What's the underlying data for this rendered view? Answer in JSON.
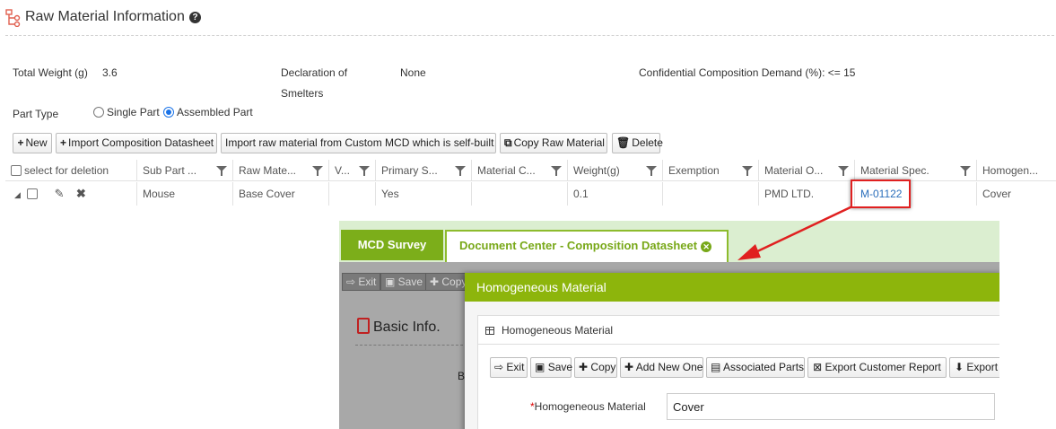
{
  "header": {
    "title": "Raw Material Information",
    "help_icon": "?"
  },
  "summary": {
    "total_weight_label": "Total Weight (g)",
    "total_weight_value": "3.6",
    "smelters_label_line1": "Declaration of",
    "smelters_label_line2": "Smelters",
    "smelters_value": "None",
    "confidential_label": "Confidential Composition Demand (%): <= 15"
  },
  "part_type": {
    "label": "Part Type",
    "options": [
      "Single Part",
      "Assembled Part"
    ],
    "selected": "Assembled Part"
  },
  "toolbar": {
    "new": "New",
    "import_datasheet": "Import Composition Datasheet",
    "import_custom": "Import raw material from Custom MCD which is self-built",
    "copy": "Copy Raw Material",
    "delete": "Delete"
  },
  "grid": {
    "select_label": "select for deletion",
    "columns": [
      "Sub Part ...",
      "Raw Mate...",
      "V...",
      "Primary S...",
      "Material C...",
      "Weight(g)",
      "Exemption",
      "Material O...",
      "Material Spec.",
      "Homogen..."
    ],
    "row": {
      "sub_part": "Mouse",
      "raw_material": "Base Cover",
      "v": "",
      "primary": "Yes",
      "material_c": "",
      "weight": "0.1",
      "exemption": "",
      "material_o": "PMD LTD.",
      "material_spec": "M-01122",
      "homogeneous": "Cover"
    }
  },
  "inset": {
    "tab_mcd": "MCD Survey",
    "tab_doc": "Document Center - Composition Datasheet",
    "bg_buttons": [
      "Exit",
      "Save",
      "Copy"
    ],
    "bg_basic_info": "Basic Info.",
    "bg_letter": "B",
    "modal_title": "Homogeneous Material",
    "panel_title": "Homogeneous Material",
    "modal_buttons": {
      "exit": "Exit",
      "save": "Save",
      "copy": "Copy",
      "add_new": "Add New One",
      "associated": "Associated Parts",
      "export_report": "Export Customer Report",
      "export": "Export"
    },
    "field_label": "Homogeneous Material",
    "field_value": "Cover"
  },
  "colors": {
    "accent_green": "#8db50c",
    "highlight_red": "#e02020",
    "link_blue": "#2a6ebb"
  }
}
